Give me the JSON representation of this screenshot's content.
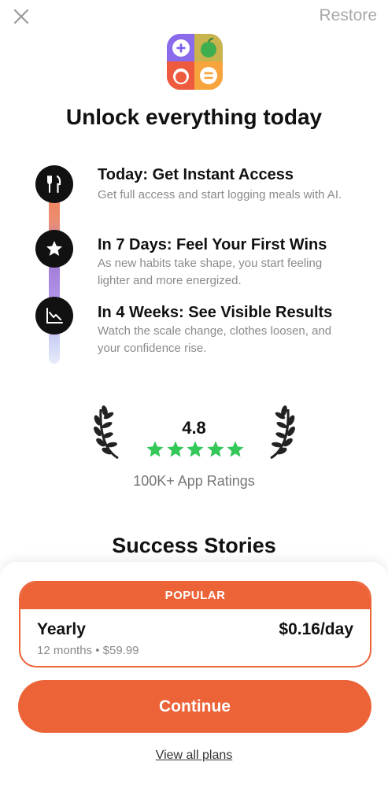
{
  "header": {
    "close_icon": "close-icon",
    "restore_label": "Restore"
  },
  "app_icon": {
    "name": "app-icon",
    "quadrant_colors": [
      "#6a6ff0",
      "#3fae4f",
      "#ec6338",
      "#f5a623"
    ]
  },
  "headline": "Unlock everything today",
  "timeline": [
    {
      "icon": "fork-knife-icon",
      "title": "Today: Get Instant Access",
      "description": "Get full access and start logging meals with AI."
    },
    {
      "icon": "star-icon",
      "title": "In 7 Days: Feel Your First Wins",
      "description": "As new habits take shape, you start feeling lighter and more energized."
    },
    {
      "icon": "trend-down-icon",
      "title": "In 4 Weeks: See Visible Results",
      "description": "Watch the scale change, clothes loosen, and your confidence rise."
    }
  ],
  "rating": {
    "value": "4.8",
    "stars": 5,
    "caption": "100K+ App Ratings",
    "star_color": "#34c759"
  },
  "stories_title": "Success Stories",
  "plan": {
    "badge": "POPULAR",
    "name": "Yearly",
    "price": "$0.16/day",
    "details": "12 months • $59.99"
  },
  "cta": {
    "continue_label": "Continue",
    "view_all_label": "View all plans"
  },
  "colors": {
    "accent": "#ec6338",
    "text_primary": "#111111",
    "text_secondary": "#8a8a8a"
  }
}
